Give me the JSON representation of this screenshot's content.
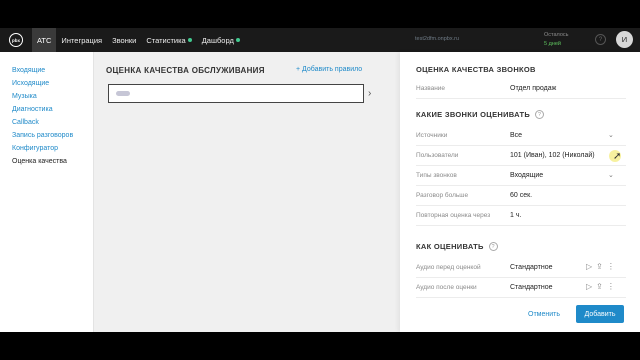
{
  "topbar": {
    "logo": "pbx",
    "nav": [
      {
        "label": "АТС",
        "dot": false
      },
      {
        "label": "Интеграция",
        "dot": false
      },
      {
        "label": "Звонки",
        "dot": false
      },
      {
        "label": "Статистика",
        "dot": true
      },
      {
        "label": "Дашборд",
        "dot": true
      }
    ],
    "domain": "test2dfm.onpbx.ru",
    "remain_label": "Осталось",
    "remain_value": "5 дней",
    "help": "?",
    "avatar": "И"
  },
  "sidebar": {
    "items": [
      "Входящие",
      "Исходящие",
      "Музыка",
      "Диагностика",
      "Callback",
      "Запись разговоров",
      "Конфигуратор",
      "Оценка качества"
    ],
    "current": "Оценка качества"
  },
  "main": {
    "title": "ОЦЕНКА КАЧЕСТВА ОБСЛУЖИВАНИЯ",
    "add_rule": "+ Добавить правило",
    "chevron": "›"
  },
  "panel": {
    "title": "ОЦЕНКА КАЧЕСТВА ЗВОНКОВ",
    "name_label": "Название",
    "name_value": "Отдел продаж",
    "which_calls": "КАКИЕ ЗВОНКИ ОЦЕНИВАТЬ",
    "sources_label": "Источники",
    "sources_value": "Все",
    "users_label": "Пользователи",
    "users_value": "101 (Иван), 102 (Николай)",
    "types_label": "Типы звонков",
    "types_value": "Входящие",
    "duration_label": "Разговор больше",
    "duration_value": "60 сек.",
    "repeat_label": "Повторная оценка через",
    "repeat_value": "1 ч.",
    "how_rate": "КАК ОЦЕНИВАТЬ",
    "audio_before_label": "Аудио перед оценкой",
    "audio_before_value": "Стандартное",
    "audio_after_label": "Аудио после оценки",
    "audio_after_value": "Стандартное",
    "cancel": "Отменить",
    "add": "Добавить"
  },
  "colors": {
    "accent": "#1f8ac9",
    "topbar": "#1a1a1a",
    "status_green": "#41c98f"
  }
}
